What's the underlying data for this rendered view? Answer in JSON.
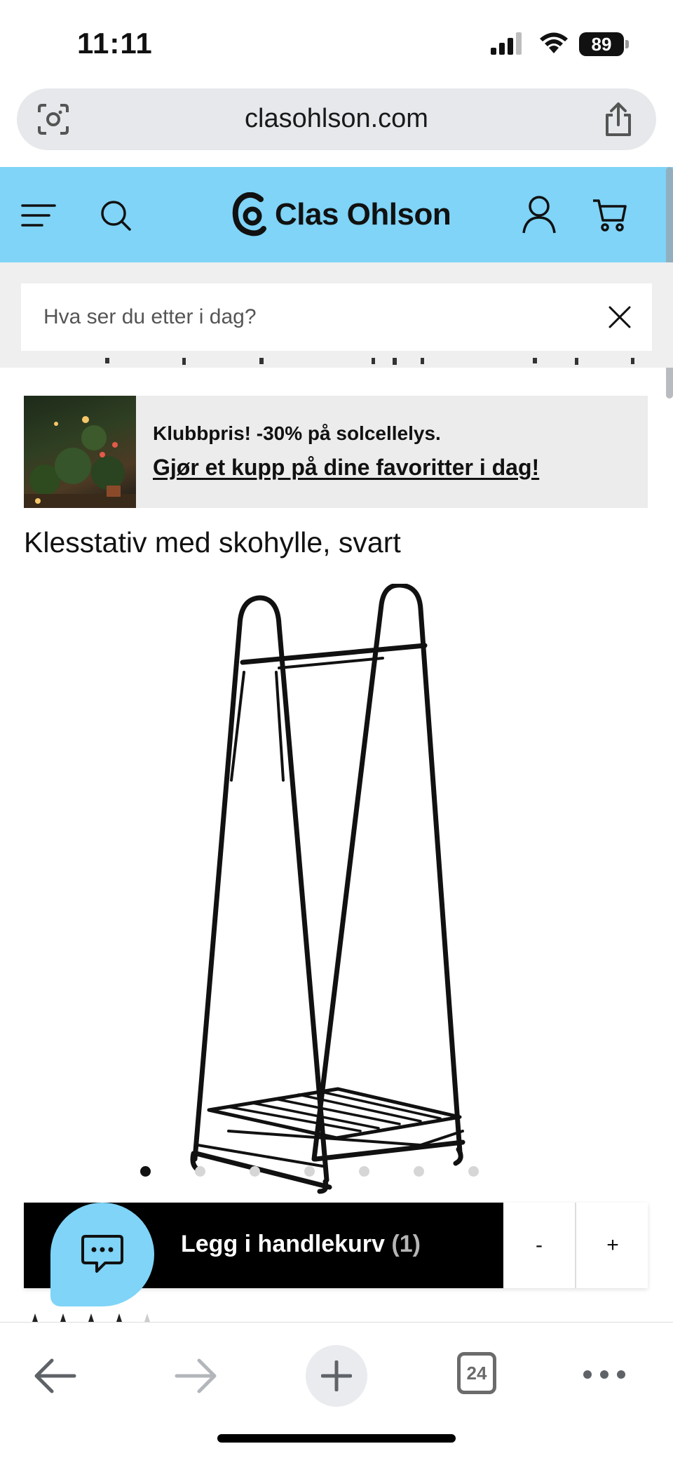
{
  "status_bar": {
    "time": "11:11",
    "battery": "89"
  },
  "browser": {
    "url": "clasohlson.com",
    "tab_count": "24"
  },
  "header": {
    "brand": "Clas Ohlson",
    "colors": {
      "header_bg": "#7fd4f7",
      "search_area_bg": "#efefef"
    }
  },
  "search": {
    "placeholder": "Hva ser du etter i dag?"
  },
  "promo": {
    "title": "Klubbpris! -30% på solcellelys.",
    "link": "Gjør et kupp på dine favoritter i dag!"
  },
  "product": {
    "title": "Klesstativ med skohylle, svart",
    "image_count": 7,
    "active_image_index": 0
  },
  "cart": {
    "add_label": "Legg i handlekurv",
    "count": "(1)",
    "minus": "-",
    "plus": "+"
  },
  "icons": {
    "menu": "hamburger-icon",
    "search": "search-icon",
    "account": "user-icon",
    "cart": "cart-icon",
    "chat": "chat-icon"
  }
}
